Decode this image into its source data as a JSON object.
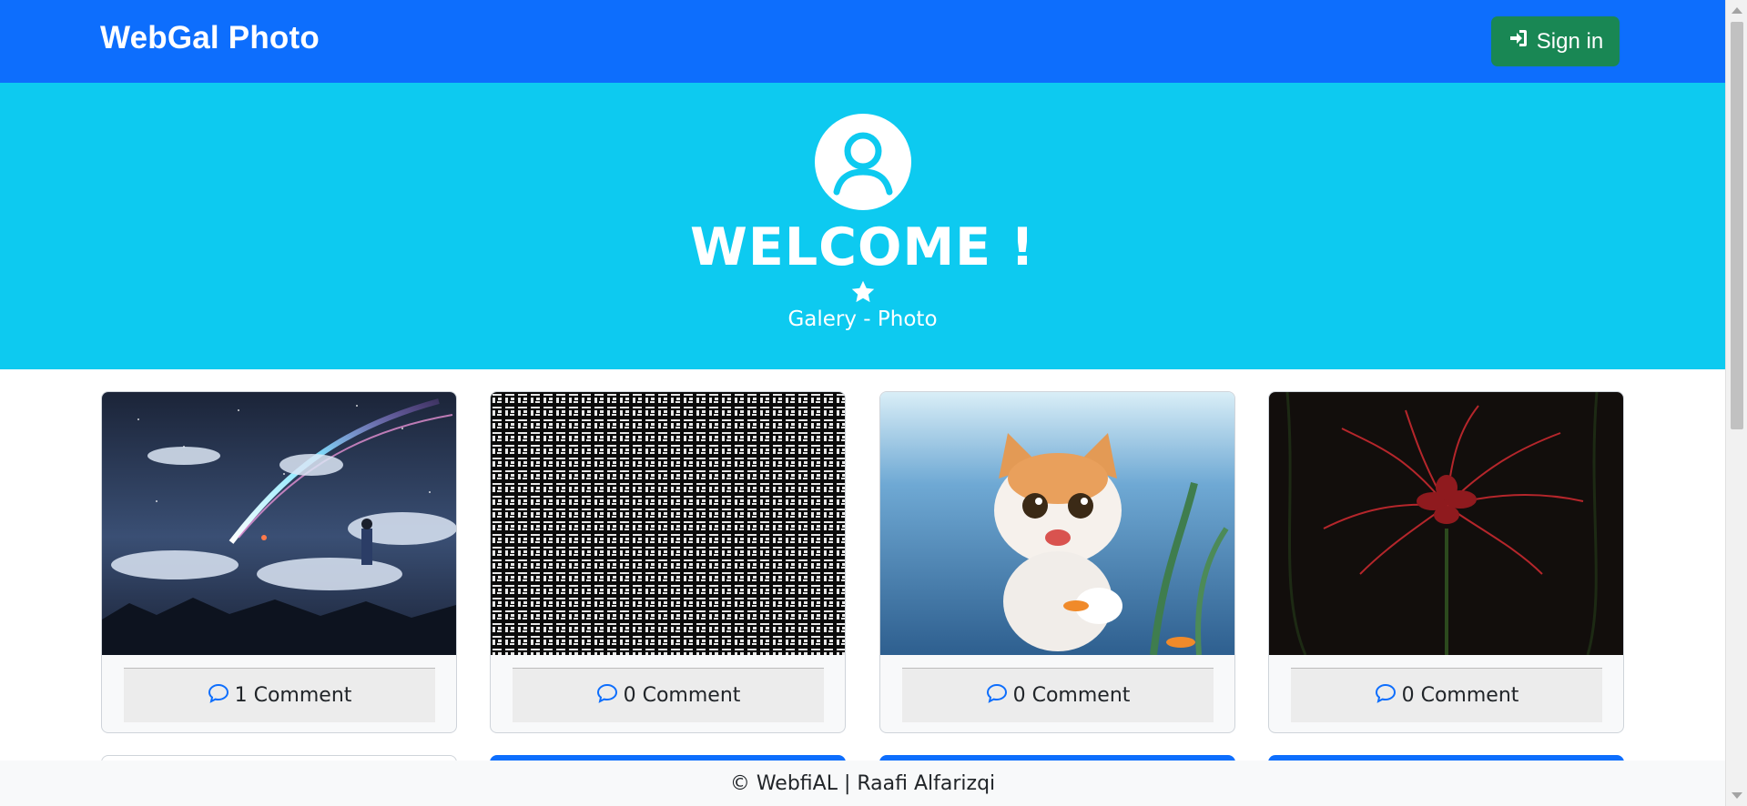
{
  "navbar": {
    "brand": "WebGal Photo",
    "signin_label": "Sign in",
    "signin_icon": "sign-in-icon",
    "color": "#0d6efd"
  },
  "hero": {
    "title": "WELCOME !",
    "subtitle": "Galery - Photo",
    "avatar_icon": "user-circle-icon",
    "star_icon": "star-icon",
    "color": "#0dcaf0"
  },
  "cards": [
    {
      "image": "night-sky-comet",
      "comment_label": "1 Comment",
      "comment_icon": "comment-icon"
    },
    {
      "image": "glyph-pattern",
      "comment_label": "0 Comment",
      "comment_icon": "comment-icon"
    },
    {
      "image": "kitten-underwater",
      "comment_label": "0 Comment",
      "comment_icon": "comment-icon"
    },
    {
      "image": "red-spider-lily",
      "comment_label": "0 Comment",
      "comment_icon": "comment-icon"
    }
  ],
  "footer": {
    "text": "© WebfiAL | Raafi Alfarizqi"
  },
  "colors": {
    "signin": "#198754",
    "comment_icon": "#0d6efd"
  }
}
